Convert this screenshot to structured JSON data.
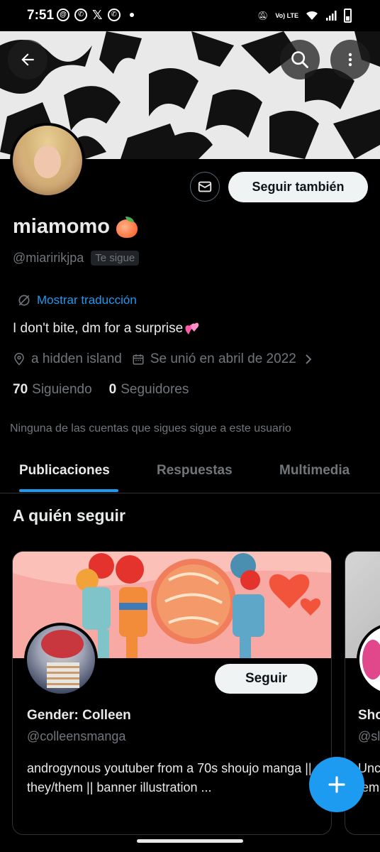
{
  "status_bar": {
    "time": "7:51",
    "network_label": "Vo) LTE"
  },
  "profile": {
    "name": "miamomo",
    "handle": "@miaririkjpa",
    "follows_you_badge": "Te sigue",
    "translate_link": "Mostrar traducción",
    "bio": "I don't bite, dm for a surprise",
    "location": "a hidden island",
    "joined": "Se unió en abril de 2022",
    "following_count": "70",
    "following_label": "Siguiendo",
    "followers_count": "0",
    "followers_label": "Seguidores",
    "mutuals_note": "Ninguna de las cuentas que sigues sigue a este usuario",
    "follow_back_label": "Seguir también"
  },
  "tabs": [
    {
      "label": "Publicaciones",
      "active": true
    },
    {
      "label": "Respuestas",
      "active": false
    },
    {
      "label": "Multimedia",
      "active": false
    }
  ],
  "who_to_follow": {
    "title": "A quién seguir",
    "cards": [
      {
        "name": "Gender: Colleen",
        "handle": "@colleensmanga",
        "bio": "androgynous youtuber from a 70s shoujo manga || they/them || banner illustration ...",
        "follow_label": "Seguir"
      },
      {
        "name": "Sho",
        "handle": "@sl",
        "bio": "Unc\nfem"
      }
    ]
  },
  "colors": {
    "accent": "#1d9bf0",
    "background": "#000000",
    "muted_text": "#71767b",
    "primary_text": "#e7e9ea",
    "border": "#2f3336"
  },
  "icons": [
    "back-arrow-icon",
    "search-icon",
    "more-vertical-icon",
    "mail-icon",
    "translate-icon",
    "location-pin-icon",
    "calendar-icon",
    "chevron-right-icon",
    "plus-icon",
    "peach-emoji-icon",
    "hearts-emoji-icon"
  ]
}
